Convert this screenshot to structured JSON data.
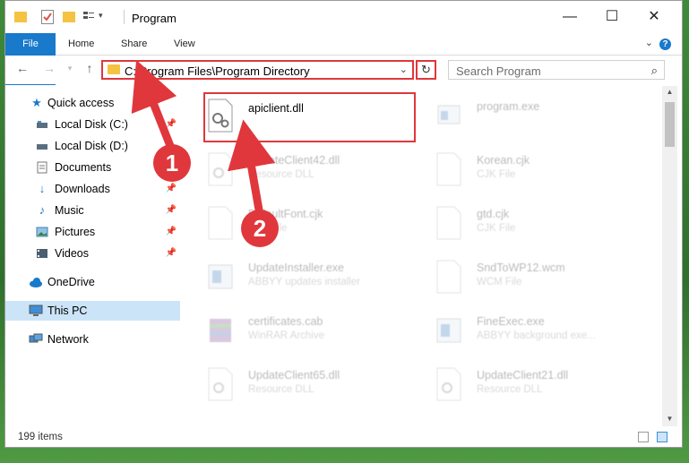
{
  "window": {
    "title": "Program",
    "controls": {
      "minimize": "—",
      "maximize": "☐",
      "close": "✕"
    }
  },
  "ribbon": {
    "tabs": [
      "File",
      "Home",
      "Share",
      "View"
    ],
    "help": "?"
  },
  "navigation": {
    "address": "C:\\Program Files\\Program Directory",
    "search_placeholder": "Search Program"
  },
  "sidebar": {
    "items": [
      {
        "label": "Quick access",
        "icon": "star-icon"
      },
      {
        "label": "Local Disk (C:)",
        "icon": "drive-icon",
        "pinned": true
      },
      {
        "label": "Local Disk (D:)",
        "icon": "drive-icon"
      },
      {
        "label": "Documents",
        "icon": "documents-icon",
        "pinned": true
      },
      {
        "label": "Downloads",
        "icon": "download-icon",
        "pinned": true
      },
      {
        "label": "Music",
        "icon": "music-icon",
        "pinned": true
      },
      {
        "label": "Pictures",
        "icon": "pictures-icon",
        "pinned": true
      },
      {
        "label": "Videos",
        "icon": "videos-icon",
        "pinned": true
      },
      {
        "label": "OneDrive",
        "icon": "cloud-icon"
      },
      {
        "label": "This PC",
        "icon": "computer-icon",
        "selected": true
      },
      {
        "label": "Network",
        "icon": "network-icon"
      }
    ]
  },
  "files": [
    {
      "name": "apiclient.dll",
      "type": "",
      "highlighted": true
    },
    {
      "name": "program.exe",
      "type": ""
    },
    {
      "name": "UpdateClient42.dll",
      "type": "Resource DLL"
    },
    {
      "name": "Korean.cjk",
      "type": "CJK File"
    },
    {
      "name": "DefaultFont.cjk",
      "type": "CJK File"
    },
    {
      "name": "gtd.cjk",
      "type": "CJK File"
    },
    {
      "name": "UpdateInstaller.exe",
      "type": "ABBYY updates installer"
    },
    {
      "name": "SndToWP12.wcm",
      "type": "WCM File"
    },
    {
      "name": "certificates.cab",
      "type": "WinRAR Archive"
    },
    {
      "name": "FineExec.exe",
      "type": "ABBYY background exe..."
    },
    {
      "name": "UpdateClient65.dll",
      "type": "Resource DLL"
    },
    {
      "name": "UpdateClient21.dll",
      "type": "Resource DLL"
    }
  ],
  "status": {
    "count": "199 items"
  },
  "callouts": [
    "1",
    "2"
  ],
  "colors": {
    "accent": "#1979ca",
    "highlight": "#e0373c",
    "selection": "#cce4f7"
  }
}
